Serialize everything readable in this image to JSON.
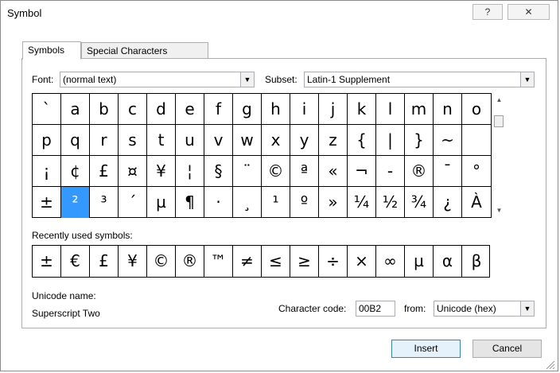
{
  "window": {
    "title": "Symbol",
    "help_glyph": "?",
    "close_glyph": "✕"
  },
  "tabs": [
    {
      "label": "Symbols",
      "active": true
    },
    {
      "label": "Special Characters",
      "active": false
    }
  ],
  "font": {
    "label": "Font:",
    "value": "(normal text)"
  },
  "subset": {
    "label": "Subset:",
    "value": "Latin-1 Supplement"
  },
  "grid": {
    "rows": [
      [
        "`",
        "a",
        "b",
        "c",
        "d",
        "e",
        "f",
        "g",
        "h",
        "i",
        "j",
        "k",
        "l",
        "m",
        "n",
        "o"
      ],
      [
        "p",
        "q",
        "r",
        "s",
        "t",
        "u",
        "v",
        "w",
        "x",
        "y",
        "z",
        "{",
        "|",
        "}",
        "~",
        ""
      ],
      [
        "¡",
        "¢",
        "£",
        "¤",
        "¥",
        "¦",
        "§",
        "¨",
        "©",
        "ª",
        "«",
        "¬",
        "-",
        "®",
        "¯",
        "°"
      ],
      [
        "±",
        "²",
        "³",
        "´",
        "µ",
        "¶",
        "·",
        "¸",
        "¹",
        "º",
        "»",
        "¼",
        "½",
        "¾",
        "¿",
        "À"
      ]
    ],
    "selected_row": 3,
    "selected_col": 1
  },
  "recent": {
    "label": "Recently used symbols:",
    "symbols": [
      "±",
      "€",
      "£",
      "¥",
      "©",
      "®",
      "™",
      "≠",
      "≤",
      "≥",
      "÷",
      "×",
      "∞",
      "µ",
      "α",
      "β"
    ]
  },
  "unicode_name": {
    "label": "Unicode name:",
    "value": "Superscript Two"
  },
  "char_code": {
    "label": "Character code:",
    "value": "00B2"
  },
  "from": {
    "label": "from:",
    "value": "Unicode (hex)"
  },
  "buttons": {
    "insert": "Insert",
    "cancel": "Cancel"
  },
  "colors": {
    "selection": "#3399ff",
    "default_button_border": "#3c7fb1"
  },
  "icons": {
    "dropdown": "triangle-down",
    "scroll_up": "triangle-up",
    "scroll_down": "triangle-down"
  }
}
